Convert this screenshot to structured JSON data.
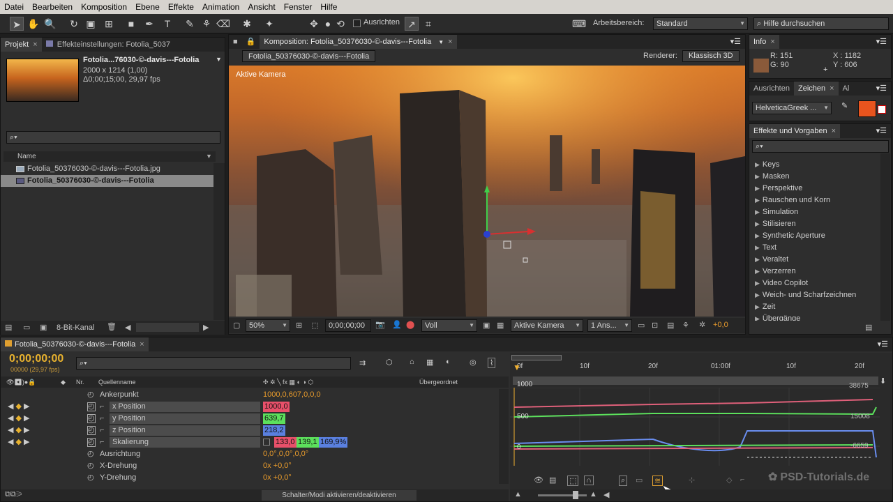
{
  "menu": [
    "Datei",
    "Bearbeiten",
    "Komposition",
    "Ebene",
    "Effekte",
    "Animation",
    "Ansicht",
    "Fenster",
    "Hilfe"
  ],
  "toolbar": {
    "align_label": "Ausrichten",
    "workspace_label": "Arbeitsbereich:",
    "workspace_value": "Standard",
    "help_placeholder": "Hilfe durchsuchen"
  },
  "project": {
    "tab_project": "Projekt",
    "tab_effects": "Effekteinstellungen: Fotolia_5037",
    "item_title": "Fotolia...76030-©-davis---Fotolia",
    "item_dims": "2000 x 1214 (1,00)",
    "item_duration": "Δ0;00;15;00, 29,97 fps",
    "col_name": "Name",
    "files": [
      "Fotolia_50376030-©-davis---Fotolia.jpg",
      "Fotolia_50376030-©-davis---Fotolia"
    ],
    "bitdepth": "8-Bit-Kanal"
  },
  "comp": {
    "tab": "Komposition: Fotolia_50376030-©-davis---Fotolia",
    "subtab": "Fotolia_50376030-©-davis---Fotolia",
    "renderer_label": "Renderer:",
    "renderer_value": "Klassisch 3D",
    "camera_label": "Aktive Kamera",
    "zoom": "50%",
    "timecode": "0;00;00;00",
    "resolution": "Voll",
    "view": "Aktive Kamera",
    "views": "1 Ans...",
    "exposure": "+0,0"
  },
  "info": {
    "tab": "Info",
    "r": "R:  151",
    "g": "G:  90",
    "x": "X : 1182",
    "y": "Y : 606",
    "swatch": "#8a5a3a"
  },
  "char": {
    "tab_align": "Ausrichten",
    "tab_char": "Zeichen",
    "tab_more": "Al",
    "font": "HelveticaGreek ...",
    "color": "#e8541e"
  },
  "effects": {
    "tab": "Effekte und Vorgaben",
    "items": [
      "Keys",
      "Masken",
      "Perspektive",
      "Rauschen und Korn",
      "Simulation",
      "Stilisieren",
      "Synthetic Aperture",
      "Text",
      "Veraltet",
      "Verzerren",
      "Video Copilot",
      "Weich- und Scharfzeichnen",
      "Zeit",
      "Übergänge"
    ]
  },
  "timeline": {
    "tab": "Fotolia_50376030-©-davis---Fotolia",
    "timecode": "0;00;00;00",
    "frames": "00000 (29,97 fps)",
    "col_nr": "Nr.",
    "col_source": "Quellenname",
    "col_parent": "Übergeordnet",
    "props": [
      {
        "name": "Ankerpunkt",
        "value": "1000,0,607,0,0,0"
      },
      {
        "name": "x Position",
        "value": "1000,0"
      },
      {
        "name": "y Position",
        "value": "639,7"
      },
      {
        "name": "z Position",
        "value": "218,2"
      },
      {
        "name": "Skalierung",
        "value1": "133,0",
        "value2": "139,1",
        "value3": "169,9%"
      },
      {
        "name": "Ausrichtung",
        "value": "0,0°,0,0°,0,0°"
      },
      {
        "name": "X-Drehung",
        "value": "0x +0,0°"
      },
      {
        "name": "Y-Drehung",
        "value": "0x +0,0°"
      }
    ],
    "toggle_label": "Schalter/Modi aktivieren/deaktivieren",
    "ruler": [
      "0f",
      "10f",
      "20f",
      "01:00f",
      "10f",
      "20f"
    ],
    "graph_labels": {
      "top": "1000",
      "mid": "500",
      "bot": "0",
      "r_top": "38675",
      "r_mid": "15008",
      "r_bot": "-6659"
    }
  },
  "watermark": "PSD-Tutorials.de"
}
